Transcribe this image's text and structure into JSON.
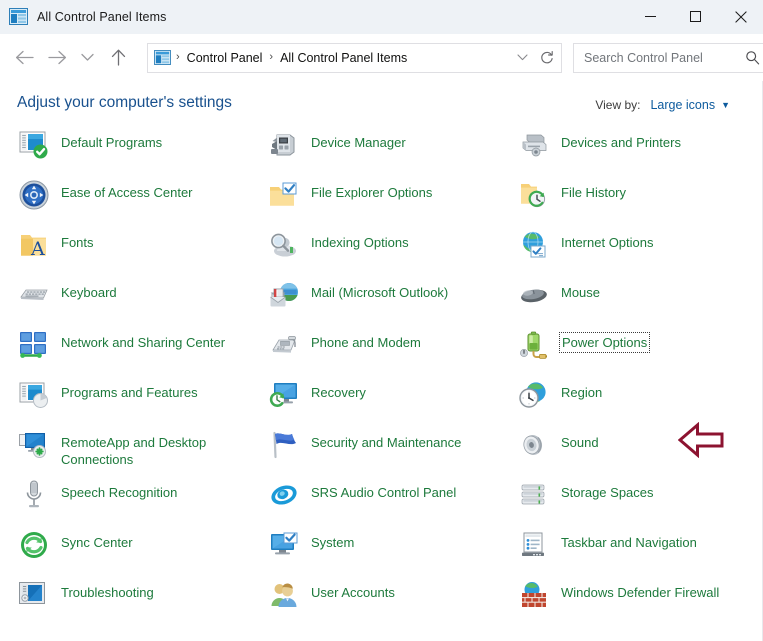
{
  "window": {
    "title": "All Control Panel Items",
    "title_icon": "control-panel-icon",
    "caption": {
      "minimize_label": "Minimize",
      "maximize_label": "Maximize",
      "close_label": "Close"
    }
  },
  "nav": {
    "back_label": "Back",
    "forward_label": "Forward",
    "recent_label": "Recent locations",
    "up_label": "Up",
    "address": {
      "icon": "control-panel-icon",
      "crumbs": [
        "Control Panel",
        "All Control Panel Items"
      ],
      "separator": "›",
      "dropdown_label": "Previous locations",
      "refresh_label": "Refresh"
    },
    "search": {
      "placeholder": "Search Control Panel",
      "value": "",
      "icon": "search-icon"
    }
  },
  "main": {
    "heading": "Adjust your computer's settings",
    "view_by": {
      "label": "View by:",
      "value": "Large icons",
      "caret": "▼"
    },
    "label_color": "#1d7a3c",
    "heading_color": "#19518e"
  },
  "items": [
    {
      "label": "Default Programs",
      "icon": "default-programs-icon",
      "col": 0,
      "row": 0,
      "focused": false
    },
    {
      "label": "Ease of Access Center",
      "icon": "ease-of-access-icon",
      "col": 0,
      "row": 1,
      "focused": false
    },
    {
      "label": "Fonts",
      "icon": "fonts-icon",
      "col": 0,
      "row": 2,
      "focused": false
    },
    {
      "label": "Keyboard",
      "icon": "keyboard-icon",
      "col": 0,
      "row": 3,
      "focused": false
    },
    {
      "label": "Network and Sharing Center",
      "icon": "network-sharing-icon",
      "col": 0,
      "row": 4,
      "focused": false
    },
    {
      "label": "Programs and Features",
      "icon": "programs-features-icon",
      "col": 0,
      "row": 5,
      "focused": false
    },
    {
      "label": "RemoteApp and Desktop Connections",
      "icon": "remoteapp-icon",
      "col": 0,
      "row": 6,
      "focused": false
    },
    {
      "label": "Speech Recognition",
      "icon": "speech-recognition-icon",
      "col": 0,
      "row": 7,
      "focused": false
    },
    {
      "label": "Sync Center",
      "icon": "sync-center-icon",
      "col": 0,
      "row": 8,
      "focused": false
    },
    {
      "label": "Troubleshooting",
      "icon": "troubleshooting-icon",
      "col": 0,
      "row": 9,
      "focused": false
    },
    {
      "label": "Device Manager",
      "icon": "device-manager-icon",
      "col": 1,
      "row": 0,
      "focused": false
    },
    {
      "label": "File Explorer Options",
      "icon": "file-explorer-options-icon",
      "col": 1,
      "row": 1,
      "focused": false
    },
    {
      "label": "Indexing Options",
      "icon": "indexing-options-icon",
      "col": 1,
      "row": 2,
      "focused": false
    },
    {
      "label": "Mail (Microsoft Outlook)",
      "icon": "mail-icon",
      "col": 1,
      "row": 3,
      "focused": false
    },
    {
      "label": "Phone and Modem",
      "icon": "phone-modem-icon",
      "col": 1,
      "row": 4,
      "focused": false
    },
    {
      "label": "Recovery",
      "icon": "recovery-icon",
      "col": 1,
      "row": 5,
      "focused": false
    },
    {
      "label": "Security and Maintenance",
      "icon": "security-maintenance-icon",
      "col": 1,
      "row": 6,
      "focused": false
    },
    {
      "label": "SRS Audio Control Panel",
      "icon": "srs-audio-icon",
      "col": 1,
      "row": 7,
      "focused": false
    },
    {
      "label": "System",
      "icon": "system-icon",
      "col": 1,
      "row": 8,
      "focused": false
    },
    {
      "label": "User Accounts",
      "icon": "user-accounts-icon",
      "col": 1,
      "row": 9,
      "focused": false
    },
    {
      "label": "Devices and Printers",
      "icon": "devices-printers-icon",
      "col": 2,
      "row": 0,
      "focused": false
    },
    {
      "label": "File History",
      "icon": "file-history-icon",
      "col": 2,
      "row": 1,
      "focused": false
    },
    {
      "label": "Internet Options",
      "icon": "internet-options-icon",
      "col": 2,
      "row": 2,
      "focused": false
    },
    {
      "label": "Mouse",
      "icon": "mouse-icon",
      "col": 2,
      "row": 3,
      "focused": false
    },
    {
      "label": "Power Options",
      "icon": "power-options-icon",
      "col": 2,
      "row": 4,
      "focused": true
    },
    {
      "label": "Region",
      "icon": "region-icon",
      "col": 2,
      "row": 5,
      "focused": false
    },
    {
      "label": "Sound",
      "icon": "sound-icon",
      "col": 2,
      "row": 6,
      "focused": false
    },
    {
      "label": "Storage Spaces",
      "icon": "storage-spaces-icon",
      "col": 2,
      "row": 7,
      "focused": false
    },
    {
      "label": "Taskbar and Navigation",
      "icon": "taskbar-navigation-icon",
      "col": 2,
      "row": 8,
      "focused": false
    },
    {
      "label": "Windows Defender Firewall",
      "icon": "windows-defender-firewall-icon",
      "col": 2,
      "row": 9,
      "focused": false
    }
  ],
  "annotation": {
    "type": "left-arrow",
    "target": "Power Options",
    "color": "#8c1330"
  }
}
